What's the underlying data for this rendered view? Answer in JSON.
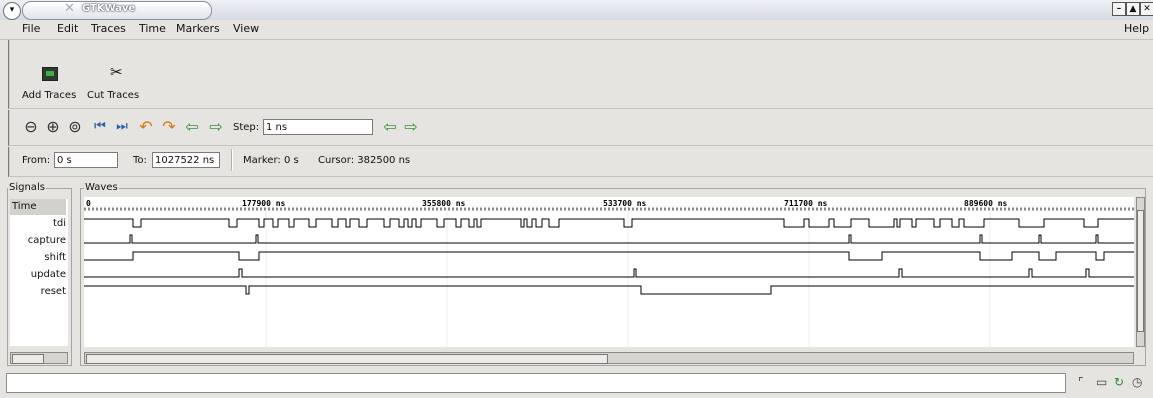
{
  "window": {
    "title": "GTKWave"
  },
  "menu": [
    "File",
    "Edit",
    "Traces",
    "Time",
    "Markers",
    "View"
  ],
  "help": "Help",
  "toolbar": {
    "add_traces": "Add Traces",
    "cut_traces": "Cut Traces"
  },
  "nav": {
    "step_label": "Step:",
    "step_value": "1 ns",
    "icons": [
      "zoom-out-icon",
      "zoom-in-icon",
      "zoom-fit-icon",
      "go-start-icon",
      "go-end-icon",
      "undo-icon",
      "redo-icon",
      "page-left-icon",
      "page-right-icon"
    ]
  },
  "timebar": {
    "from_label": "From:",
    "from_value": "0 s",
    "to_label": "To:",
    "to_value": "1027522 ns",
    "marker": "Marker:  0 s",
    "cursor": "Cursor:  382500 ns"
  },
  "signals": {
    "title": "Signals",
    "items": [
      "Time",
      "tdi",
      "capture",
      "shift",
      "update",
      "reset"
    ]
  },
  "waves": {
    "title": "Waves",
    "time_labels": [
      "0",
      "177900 ns",
      "355800 ns",
      "533700 ns",
      "711700 ns",
      "889600 ns"
    ]
  }
}
